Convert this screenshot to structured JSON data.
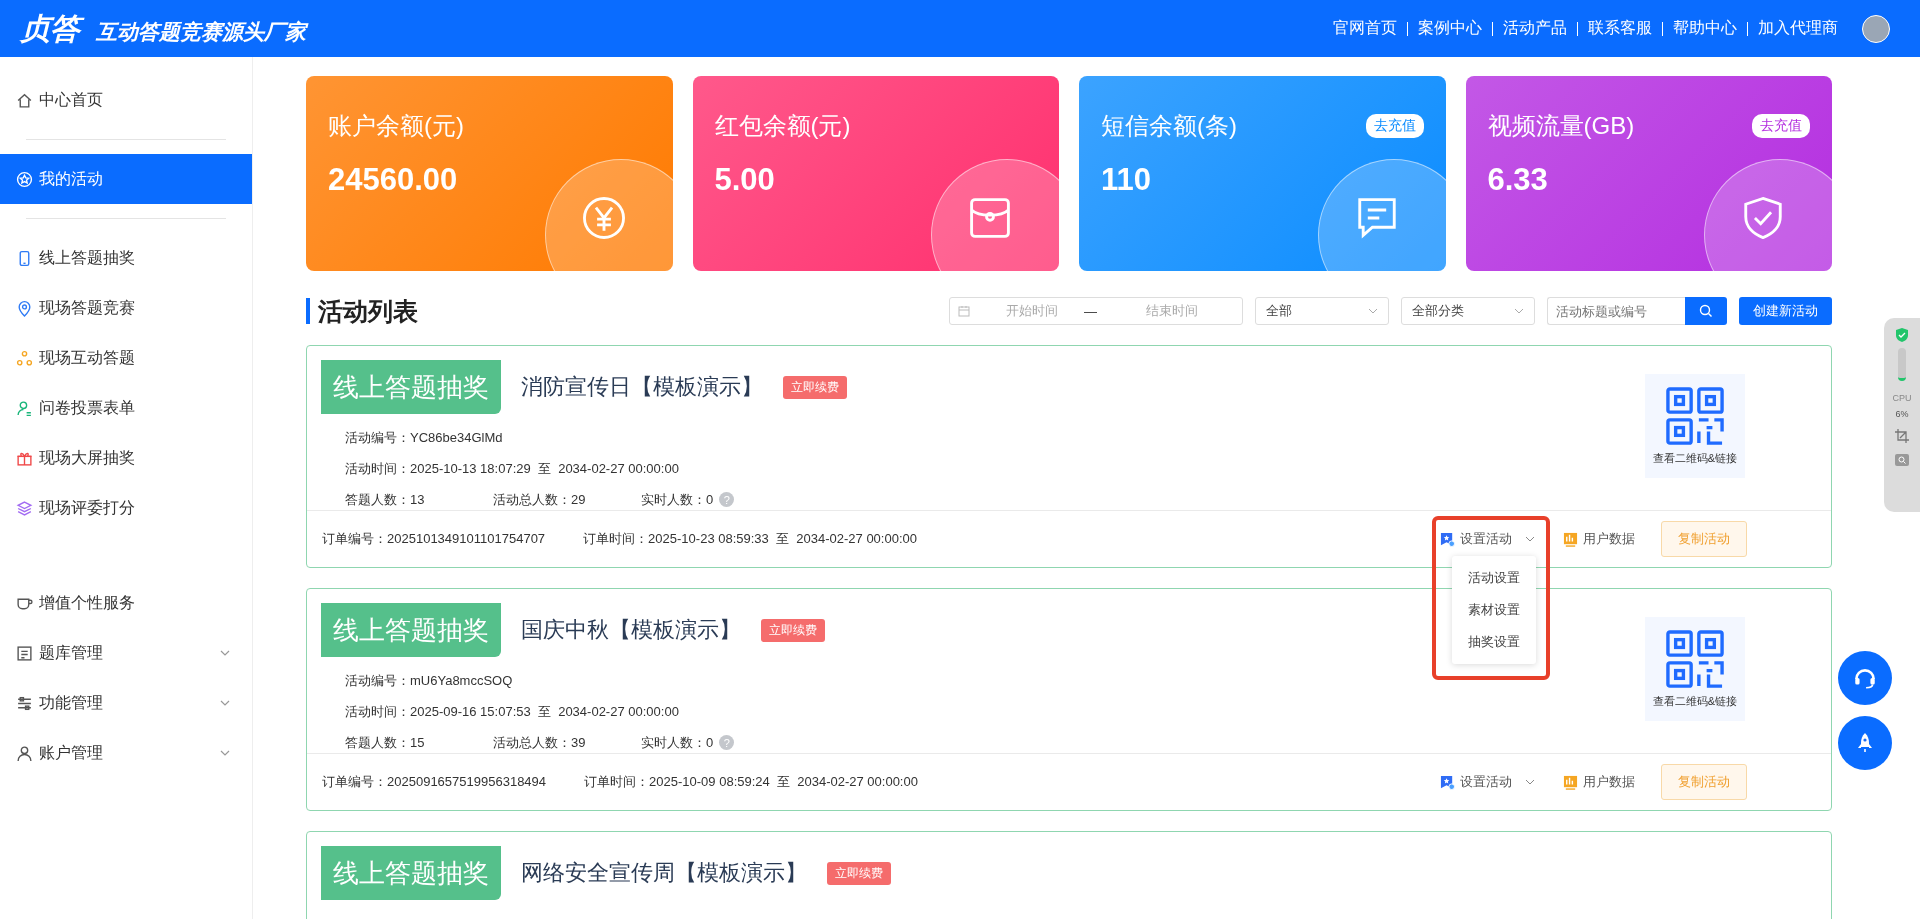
{
  "header": {
    "logo": "贞答",
    "slogan": "互动答题竞赛源头厂家",
    "nav": [
      "官网首页",
      "案例中心",
      "活动产品",
      "联系客服",
      "帮助中心",
      "加入代理商"
    ]
  },
  "sidebar": {
    "groups": [
      [
        {
          "label": "中心首页",
          "selected": false,
          "expandable": false
        }
      ],
      [
        {
          "label": "我的活动",
          "selected": true,
          "expandable": false
        }
      ],
      [
        {
          "label": "线上答题抽奖",
          "selected": false,
          "expandable": false
        },
        {
          "label": "现场答题竞赛",
          "selected": false,
          "expandable": false
        },
        {
          "label": "现场互动答题",
          "selected": false,
          "expandable": false
        },
        {
          "label": "问卷投票表单",
          "selected": false,
          "expandable": false
        },
        {
          "label": "现场大屏抽奖",
          "selected": false,
          "expandable": false
        },
        {
          "label": "现场评委打分",
          "selected": false,
          "expandable": false
        }
      ],
      [
        {
          "label": "增值个性服务",
          "selected": false,
          "expandable": false
        },
        {
          "label": "题库管理",
          "selected": false,
          "expandable": true
        },
        {
          "label": "功能管理",
          "selected": false,
          "expandable": true
        },
        {
          "label": "账户管理",
          "selected": false,
          "expandable": true
        }
      ]
    ]
  },
  "stats": [
    {
      "title": "账户余额(元)",
      "value": "24560.00",
      "kind": "yen",
      "color": "#ff7a00"
    },
    {
      "title": "红包余额(元)",
      "value": "5.00",
      "kind": "envelope",
      "color": "#ff2f6e"
    },
    {
      "title": "短信余额(条)",
      "value": "110",
      "kind": "message",
      "color": "#0b8cff",
      "action": "去充值"
    },
    {
      "title": "视频流量(GB)",
      "value": "6.33",
      "kind": "shield",
      "color": "#b42ee0",
      "action": "去充值"
    }
  ],
  "list": {
    "title": "活动列表",
    "filters": {
      "start_placeholder": "开始时间",
      "separator": "—",
      "end_placeholder": "结束时间",
      "status": "全部",
      "category": "全部分类",
      "search_placeholder": "活动标题或编号"
    },
    "create_button": "创建新活动"
  },
  "activities": [
    {
      "type": "线上答题抽奖",
      "title": "消防宣传日【模板演示】",
      "tag": "立即续费",
      "code_label": "活动编号：",
      "code": "YC86be34GlMd",
      "time_label": "活动时间：",
      "start": "2025-10-13 18:07:29",
      "to": "至",
      "end": "2034-02-27 00:00:00",
      "answer_label": "答题人数：",
      "answers": "13",
      "total_label": "活动总人数：",
      "total": "29",
      "live_label": "实时人数：",
      "live": "0",
      "help": "?",
      "qr": "查看二维码&链接",
      "order_label": "订单编号：",
      "order": "2025101349101101754707",
      "order_time_label": "订单时间：",
      "order_start": "2025-10-23 08:59:33",
      "order_to": "至",
      "order_end": "2034-02-27 00:00:00",
      "settings": "设置活动",
      "menu": [
        "活动设置",
        "素材设置",
        "抽奖设置"
      ],
      "highlighted": true,
      "data": "用户数据",
      "copy": "复制活动"
    },
    {
      "type": "线上答题抽奖",
      "title": "国庆中秋【模板演示】",
      "tag": "立即续费",
      "code_label": "活动编号：",
      "code": "mU6Ya8mccSOQ",
      "time_label": "活动时间：",
      "start": "2025-09-16 15:07:53",
      "to": "至",
      "end": "2034-02-27 00:00:00",
      "answer_label": "答题人数：",
      "answers": "15",
      "total_label": "活动总人数：",
      "total": "39",
      "live_label": "实时人数：",
      "live": "0",
      "help": "?",
      "qr": "查看二维码&链接",
      "order_label": "订单编号：",
      "order": "2025091657519956318494",
      "order_time_label": "订单时间：",
      "order_start": "2025-10-09 08:59:24",
      "order_to": "至",
      "order_end": "2034-02-27 00:00:00",
      "settings": "设置活动",
      "data": "用户数据",
      "copy": "复制活动"
    },
    {
      "type": "线上答题抽奖",
      "title": "网络安全宣传周【模板演示】",
      "tag": "立即续费"
    }
  ],
  "monitor": {
    "label": "CPU",
    "reading": "6%"
  }
}
